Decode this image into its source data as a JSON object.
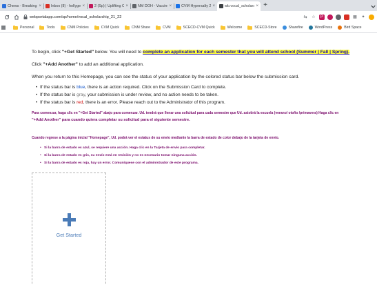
{
  "tabs": [
    {
      "title": "Chews - Breaking News",
      "favicon_color": "#2a6fdb",
      "active": false
    },
    {
      "title": "Inbox (8) - hollygeo@ga",
      "favicon_color": "#d93025",
      "active": false
    },
    {
      "title": "2 (Sp) | Uplifting Centerpi",
      "favicon_color": "#c2185b",
      "active": false
    },
    {
      "title": "NM DOH - Vaccine Registr",
      "favicon_color": "#5f6368",
      "active": false
    },
    {
      "title": "CVM Hypersalty 2021 - Zorz",
      "favicon_color": "#1a73e8",
      "active": false
    },
    {
      "title": "wb.vocal_scholarship_21_22",
      "favicon_color": "#3c4043",
      "active": true
    }
  ],
  "tab_close_glyph": "×",
  "newtab_glyph": "+",
  "omnibox": {
    "url": "webportalapp.com/sp/home/vocal_scholarship_21_22"
  },
  "bookmarks": [
    {
      "label": "Personal",
      "kind": "folder"
    },
    {
      "label": "Tools",
      "kind": "folder"
    },
    {
      "label": "CNM Policies",
      "kind": "folder"
    },
    {
      "label": "CVM Quick",
      "kind": "folder"
    },
    {
      "label": "CNM Share",
      "kind": "folder"
    },
    {
      "label": "CVM",
      "kind": "folder"
    },
    {
      "label": "SCECD-CVM Quick",
      "kind": "folder"
    },
    {
      "label": "Welcome",
      "kind": "folder"
    },
    {
      "label": "SCECD-Store",
      "kind": "folder"
    },
    {
      "label": "Sharefire",
      "kind": "fav",
      "color": "#3a8dde"
    },
    {
      "label": "WordPress",
      "kind": "fav",
      "color": "#21759b"
    },
    {
      "label": "Bird Space",
      "kind": "fav",
      "color": "#e8710a"
    }
  ],
  "main": {
    "line1_a": "To begin, click ",
    "line1_b": "\"+Get Started\"",
    "line1_c": " below. You will need to ",
    "line1_link": "complete an application for each semester that you will attend school (Summer | Fall | Spring).",
    "line2_a": "Click ",
    "line2_b": "\"+Add Another\"",
    "line2_c": " to add an additional application.",
    "line3": "When you return to this Homepage, you can see the status of your application by the colored status bar below the submission card.",
    "bullet1_a": "If the status bar is ",
    "bullet1_color": "blue",
    "bullet1_b": ", there is an action required. Click on the Submission Card to complete.",
    "bullet2_a": "If the status bar is ",
    "bullet2_color": "gray",
    "bullet2_b": ", your submission is under review, and no action needs to be taken.",
    "bullet3_a": "If the status bar is ",
    "bullet3_color": "red",
    "bullet3_b": ", there is an error. Please reach out to the Administrator of this program.",
    "es_para1_a": "Para comenzar, haga clic en \"+Get Started\" abajo para comenzar. Ud. tendrá que llenar una solicitud para cada semestre que Ud. asistirá la escuela (verano/ otoño /primavera) Haga clic en",
    "es_para1_b": "\"+Add Another\" para cuando quiera completar su solicitud para el siguiente semestre.",
    "es_para2": "Cuando regrese a la página inicial \"Homepage\", Ud. podrá ver el estatus de su envío mediante la barra de estado de color debajo de la tarjeta de envío.",
    "es_bullet1": "Si la barra de estado es azul, se requiere una acción. Haga clic en la Tarjeta de envío para completar.",
    "es_bullet2": "Si la barra de estado es gris, su envío está en revisión y no es necesario tomar ninguna acción.",
    "es_bullet3": "Si la barra de estado es roja, hay un error. Comuníquese con el administrador de este programa."
  },
  "card": {
    "label": "Get Started",
    "icon": "plus-icon",
    "accent": "#4a7bb7"
  },
  "colors": {
    "status_blue": "#1155cc",
    "status_gray": "#777777",
    "status_red": "#d00000",
    "spanish_text": "#7a0b6b",
    "link_highlight": "#ffff3a",
    "folder": "#f9c532"
  }
}
